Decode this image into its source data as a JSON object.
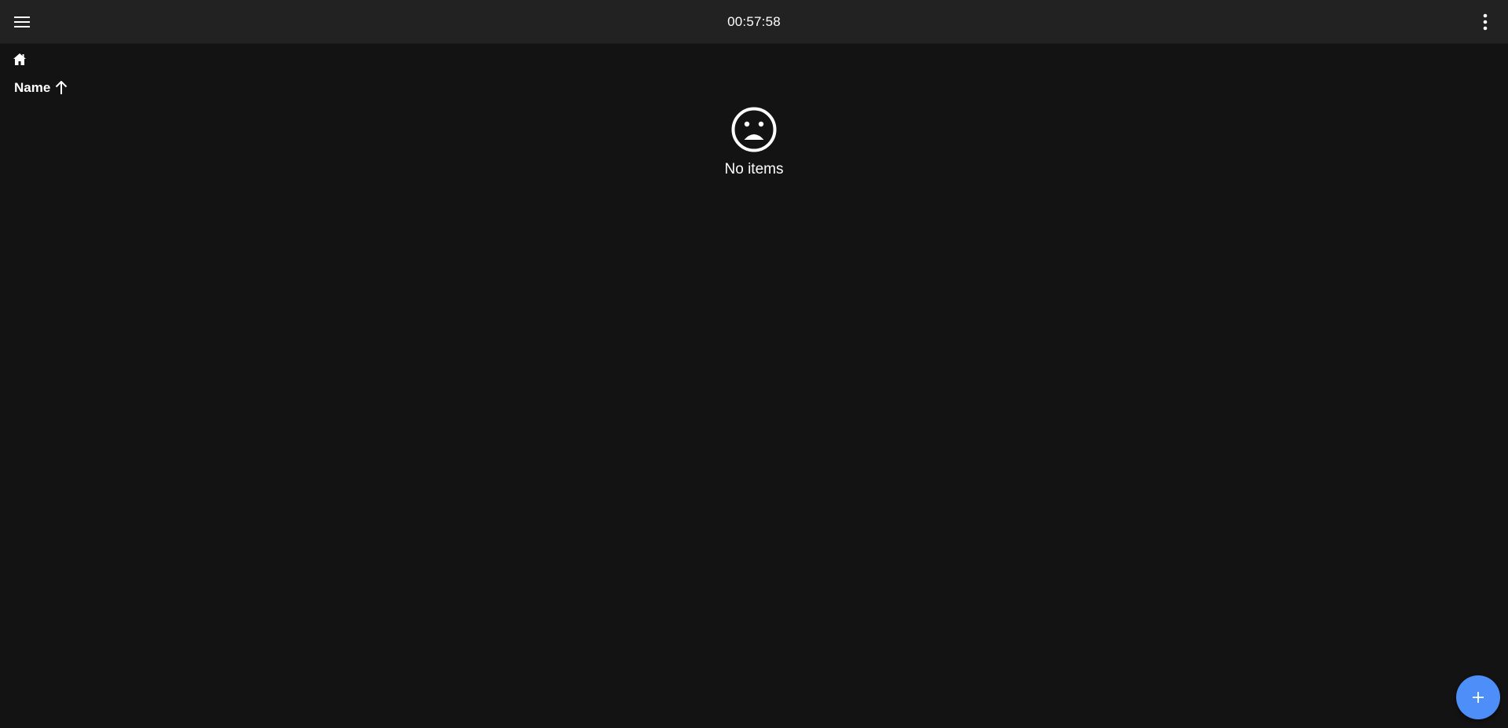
{
  "header": {
    "menu_icon": "menu-icon",
    "clock": "00:57:58",
    "more_icon": "more-vert-icon"
  },
  "breadcrumb": {
    "home_icon": "home-icon"
  },
  "list": {
    "sort_label": "Name",
    "sort_direction_icon": "arrow-up-icon"
  },
  "empty_state": {
    "icon": "sad-face-icon",
    "label": "No items"
  },
  "fab": {
    "icon": "plus-icon",
    "color": "#4d8ef8"
  },
  "colors": {
    "background": "#131313",
    "topbar": "#222222",
    "text": "#ffffff"
  }
}
